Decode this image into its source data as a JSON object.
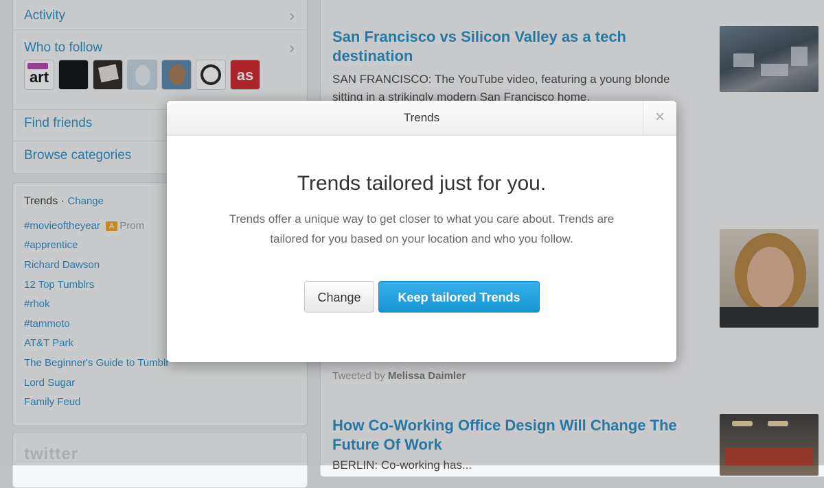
{
  "sidebar": {
    "nav": [
      {
        "label": "Activity",
        "has_chevron": true
      },
      {
        "label": "Who to follow",
        "has_chevron": true
      },
      {
        "label": "Find friends",
        "has_chevron": false
      },
      {
        "label": "Browse categories",
        "has_chevron": false
      }
    ],
    "avatars": [
      "art-avatar",
      "black-avatar",
      "card-avatar",
      "egg-avatar",
      "face-avatar",
      "ring-avatar",
      "lastfm-avatar"
    ],
    "avatar_art_text": "art",
    "avatar_lastfm_text": "as",
    "trends": {
      "title": "Trends",
      "separator": " · ",
      "change_label": "Change",
      "items": [
        {
          "label": "#movieoftheyear",
          "promoted_badge": "A",
          "promoted_text": "Prom"
        },
        {
          "label": "#apprentice"
        },
        {
          "label": "Richard Dawson"
        },
        {
          "label": "12 Top Tumblrs"
        },
        {
          "label": "#rhok"
        },
        {
          "label": "#tammoto"
        },
        {
          "label": "AT&T Park"
        },
        {
          "label": "The Beginner's Guide to Tumblr"
        },
        {
          "label": "Lord Sugar"
        },
        {
          "label": "Family Feud"
        }
      ]
    },
    "logo": "twitter"
  },
  "stories": [
    {
      "title": "San Francisco vs Silicon Valley as a tech destination",
      "body": "SAN FRANCISCO: The YouTube video, featuring a young blonde sitting in a strikingly modern San Francisco home,"
    },
    {
      "tweeted_prefix": "Tweeted by",
      "tweeted_by": "Melissa Daimler"
    },
    {
      "title": "How Co-Working Office Design Will Change The Future Of Work",
      "body": "BERLIN: Co-working has..."
    }
  ],
  "modal": {
    "title": "Trends",
    "close_label": "×",
    "heading": "Trends tailored just for you.",
    "description": "Trends offer a unique way to get closer to what you care about. Trends are tailored for you based on your location and who you follow.",
    "buttons": {
      "change": "Change",
      "keep": "Keep tailored Trends"
    }
  },
  "colors": {
    "link": "#2a8ec2",
    "primary_button": "#1a9ad9",
    "promoted_badge": "#f0a51f"
  }
}
